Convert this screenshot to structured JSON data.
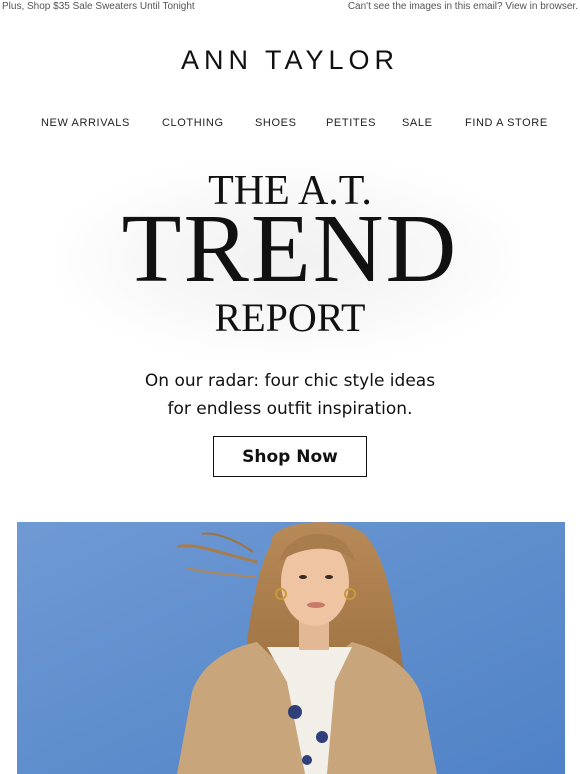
{
  "preheader": {
    "left_text": "Plus, Shop $35 Sale Sweaters Until Tonight",
    "right_text": "Can't see the images in this email? View in browser."
  },
  "brand": {
    "logo_text": "ANN TAYLOR"
  },
  "nav": {
    "items": [
      {
        "label": "NEW ARRIVALS"
      },
      {
        "label": "CLOTHING"
      },
      {
        "label": "SHOES"
      },
      {
        "label": "PETITES"
      },
      {
        "label": "SALE"
      },
      {
        "label": "FIND A STORE"
      }
    ]
  },
  "hero": {
    "line1": "THE A.T.",
    "line2": "TREND",
    "line3": "REPORT",
    "subcopy_line1": "On our radar: four chic style ideas",
    "subcopy_line2": "for endless outfit inspiration.",
    "cta_label": "Shop Now"
  },
  "colors": {
    "photo_background": "#5f8fce",
    "text": "#111111"
  }
}
